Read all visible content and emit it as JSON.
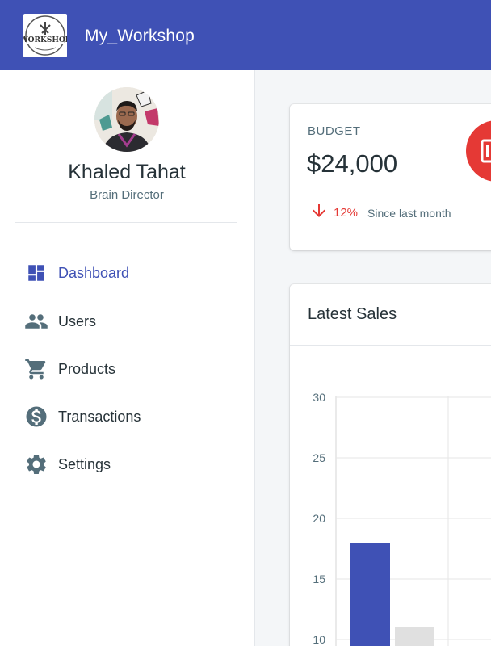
{
  "app": {
    "title": "My_Workshop",
    "logo_text": "WORKSHOP"
  },
  "user": {
    "name": "Khaled Tahat",
    "role": "Brain Director"
  },
  "nav": {
    "items": [
      {
        "label": "Dashboard",
        "icon": "dashboard-icon",
        "active": true
      },
      {
        "label": "Users",
        "icon": "users-icon",
        "active": false
      },
      {
        "label": "Products",
        "icon": "cart-icon",
        "active": false
      },
      {
        "label": "Transactions",
        "icon": "dollar-icon",
        "active": false
      },
      {
        "label": "Settings",
        "icon": "gear-icon",
        "active": false
      }
    ]
  },
  "budget": {
    "label": "BUDGET",
    "value": "$24,000",
    "change": "12%",
    "change_text": "Since last month",
    "icon": "money-icon"
  },
  "colors": {
    "primary": "#3f51b5",
    "danger": "#e53935",
    "text": "#263238",
    "secondary_text": "#546e7a",
    "bar_previous": "#e0e0e0"
  },
  "sales": {
    "title": "Latest Sales"
  },
  "chart_data": {
    "type": "bar",
    "title": "Latest Sales",
    "categories": [
      "",
      ""
    ],
    "series": [
      {
        "values": [
          18,
          null
        ]
      },
      {
        "values": [
          11,
          null
        ]
      }
    ],
    "yticks": [
      10,
      15,
      20,
      25,
      30
    ],
    "ylim": [
      0,
      30
    ],
    "grid": true
  }
}
